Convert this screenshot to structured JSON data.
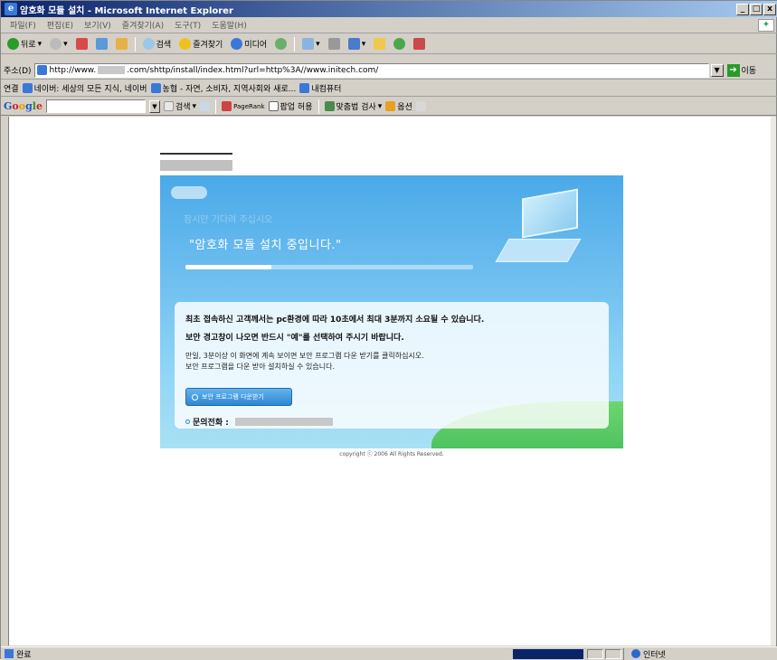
{
  "window": {
    "title": "암호화 모듈 설치 - Microsoft Internet Explorer",
    "minimize": "_",
    "maximize": "□",
    "close": "x"
  },
  "menu": [
    "파일(F)",
    "편집(E)",
    "보기(V)",
    "즐겨찾기(A)",
    "도구(T)",
    "도움말(H)"
  ],
  "toolbar": {
    "back": "뒤로",
    "search": "검색",
    "favorites": "즐겨찾기",
    "media": "미디어"
  },
  "address": {
    "label": "주소(D)",
    "url_prefix": "http://www.",
    "url_suffix": ".com/shttp/install/index.html?url=http%3A//www.initech.com/",
    "go": "이동"
  },
  "links": {
    "label": "연결",
    "items": [
      "네이버: 세상의 모든 지식, 네이버",
      "농협 - 자연, 소비자, 지역사회와 새로...",
      "내컴퓨터"
    ]
  },
  "googlebar": {
    "brand": "Google",
    "search": "검색",
    "pagerank": "PageRank",
    "popup": "팝업 허용",
    "spell": "맞춤법 검사",
    "options": "옵션"
  },
  "page": {
    "faint_text": "잠시만 기다려 주십시오",
    "headline": "\"암호화 모듈 설치 중입니다.\"",
    "progress": 0.3,
    "line1": "최초 접속하신 고객께서는 pc환경에 따라 10초에서 최대 3분까지 소요될 수 있습니다.",
    "line2": "보안 경고창이 나오면 반드시 \"예\"를 선택하여 주시기 바랍니다.",
    "line3": "만일, 3분이상 이 화면에 계속 보이면 보안 프로그램 다운 받기를 클릭하십시오.",
    "line4": "보안 프로그램을 다운 받아 설치하실 수 있습니다.",
    "download_button": "보안 프로그램 다운받기",
    "contact_label": "문의전화 :",
    "copyright": "copyright ⓒ 2006 All Rights Reserved."
  },
  "status": {
    "text": "완료",
    "zone": "인터넷"
  },
  "colors": {
    "banner": "#4aa9e8",
    "button": "#2f86d2",
    "hill": "#3fb85a"
  }
}
